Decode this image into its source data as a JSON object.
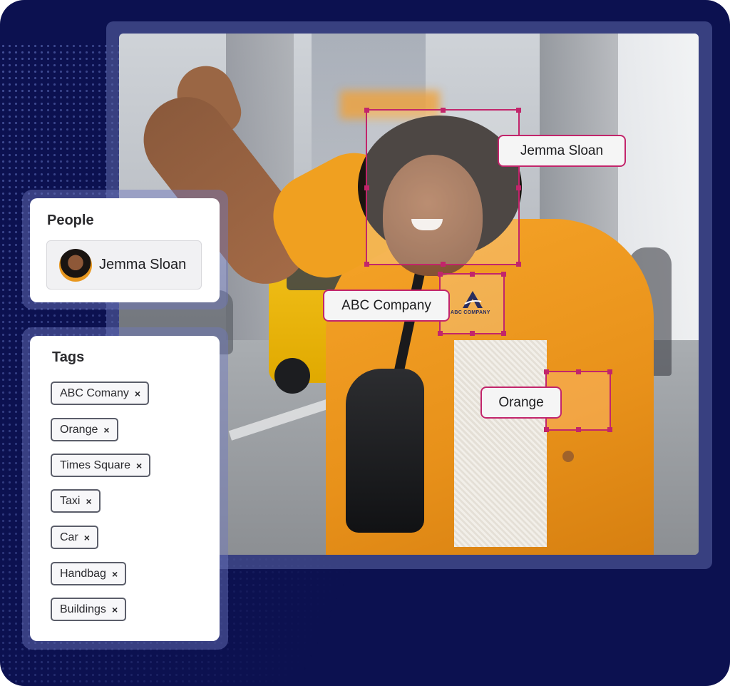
{
  "people_panel": {
    "title": "People",
    "person": {
      "name": "Jemma Sloan",
      "avatar": "avatar-photo"
    }
  },
  "tags_panel": {
    "title": "Tags",
    "remove_glyph": "×",
    "tags": [
      "ABC Comany",
      "Orange",
      "Times Square",
      "Taxi",
      "Car",
      "Handbag",
      "Buildings"
    ]
  },
  "detections": [
    {
      "label": "Jemma Sloan"
    },
    {
      "label": "ABC Company",
      "logo_text": "ABC COMPANY"
    },
    {
      "label": "Orange"
    }
  ],
  "colors": {
    "background": "#0c1150",
    "accent": "#c2256b",
    "panel": "#ffffff"
  },
  "icons": [
    "close-icon",
    "abc-company-logo-icon"
  ]
}
